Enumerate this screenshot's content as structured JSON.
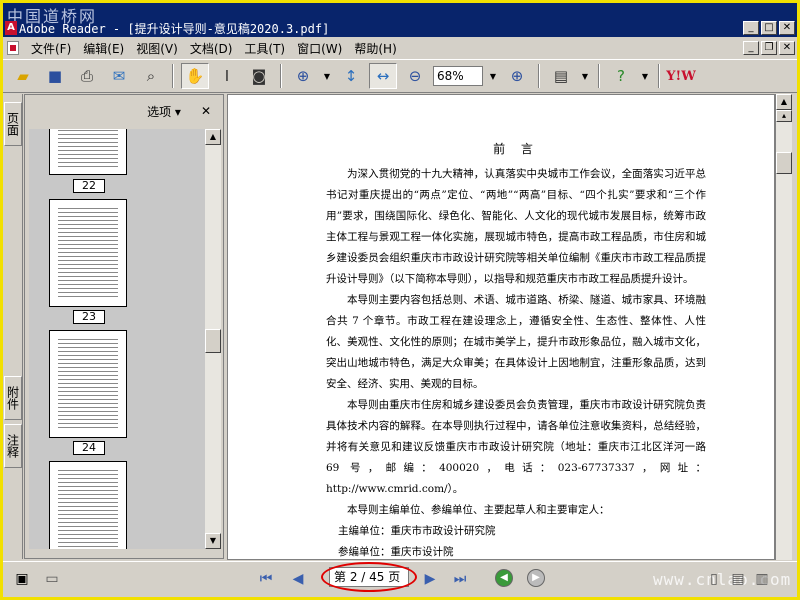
{
  "window": {
    "watermark": "中国道桥网",
    "title": "Adobe Reader - [提升设计导则-意见稿2020.3.pdf]",
    "app_icon": "A"
  },
  "menu": {
    "items": [
      "文件(F)",
      "编辑(E)",
      "视图(V)",
      "文档(D)",
      "工具(T)",
      "窗口(W)",
      "帮助(H)"
    ]
  },
  "toolbar": {
    "zoom_value": "68%",
    "yahoo_label": "Y!W"
  },
  "left_tabs": {
    "pages": "页面",
    "attachments": "附件",
    "comments": "注释"
  },
  "nav_panel": {
    "options_label": "选项 ▾",
    "close_label": "✕",
    "thumbnails": [
      {
        "label": "22"
      },
      {
        "label": "23"
      },
      {
        "label": "24"
      }
    ]
  },
  "document": {
    "title": "前  言",
    "paragraphs": [
      "为深入贯彻党的十九大精神，认真落实中央城市工作会议，全面落实习近平总书记对重庆提出的“两点”定位、“两地”“两高”目标、“四个扎实”要求和“三个作用”要求，围绕国际化、绿色化、智能化、人文化的现代城市发展目标，统筹市政主体工程与景观工程一体化实施，展现城市特色，提高市政工程品质，市住房和城乡建设委员会组织重庆市市政设计研究院等相关单位编制《重庆市市政工程品质提升设计导则》（以下简称本导则），以指导和规范重庆市市政工程品质提升设计。",
      "本导则主要内容包括总则、术语、城市道路、桥梁、隧道、城市家具、环境融合共 7 个章节。市政工程在建设理念上，遵循安全性、生态性、整体性、人性化、美观性、文化性的原则；在城市美学上，提升市政形象品位，融入城市文化，突出山地城市特色，满足大众审美；在具体设计上因地制宜，注重形象品质，达到安全、经济、实用、美观的目标。",
      "本导则由重庆市住房和城乡建设委员会负责管理，重庆市市政设计研究院负责具体技术内容的解释。在本导则执行过程中，请各单位注意收集资料，总结经验，并将有关意见和建议反馈重庆市市政设计研究院（地址：重庆市江北区洋河一路 69 号，邮编：400020，电话：023-67737337，网址：http://www.cmrid.com/）。",
      "本导则主编单位、参编单位、主要起草人和主要审定人："
    ],
    "lines": [
      "主编单位：重庆市市政设计研究院",
      "参编单位：重庆市设计院"
    ]
  },
  "statusbar": {
    "page_display": "第 2 / 45 页",
    "watermark": "www.cnlao.com"
  }
}
